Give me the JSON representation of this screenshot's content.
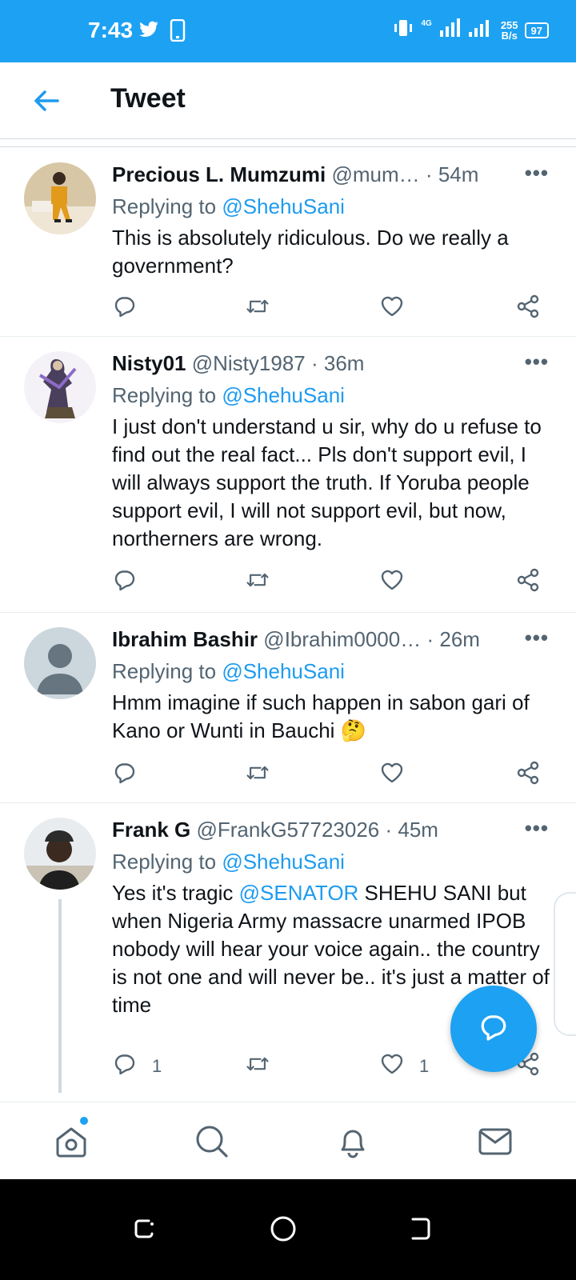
{
  "status_bar": {
    "time": "7:43",
    "network_type": "4G",
    "speed_value": "255",
    "speed_unit": "B/s",
    "battery": "97",
    "bg_color": "#1da1f2"
  },
  "header": {
    "title": "Tweet"
  },
  "tweets": [
    {
      "name": "Precious L. Mumzumi",
      "handle": "@mum…",
      "time": "54m",
      "replying_label": "Replying to",
      "replying_to": "@ShehuSani",
      "body": "This is absolutely ridiculous. Do we really a government?",
      "reply_count": "",
      "like_count": ""
    },
    {
      "name": "Nisty01",
      "handle": "@Nisty1987",
      "time": "36m",
      "replying_label": "Replying to",
      "replying_to": "@ShehuSani",
      "body": "I just don't understand u sir, why do u refuse to find out the real fact... Pls don't support evil, I will always support the truth. If Yoruba people support evil, I will not support evil, but now, northerners are wrong.",
      "reply_count": "",
      "like_count": ""
    },
    {
      "name": "Ibrahim Bashir",
      "handle": "@Ibrahim0000…",
      "time": "26m",
      "replying_label": "Replying to",
      "replying_to": "@ShehuSani",
      "body": "Hmm imagine if such happen in sabon gari of Kano or  Wunti in Bauchi 🤔",
      "reply_count": "",
      "like_count": ""
    },
    {
      "name": "Frank G",
      "handle": "@FrankG57723026",
      "time": "45m",
      "replying_label": "Replying to",
      "replying_to": "@ShehuSani",
      "body_pre": "Yes it's tragic ",
      "body_mention": "@SENATOR",
      "body_post": " SHEHU SANI but when Nigeria Army massacre unarmed IPOB nobody will hear your voice again.. the country is not one and will never be.. it's just a matter of time",
      "reply_count": "1",
      "like_count": "1"
    }
  ],
  "icons": {
    "back": "arrow-left-icon",
    "reply": "reply-icon",
    "retweet": "retweet-icon",
    "like": "heart-icon",
    "share": "share-icon",
    "more": "more-icon",
    "compose": "compose-reply-icon",
    "home": "home-icon",
    "search": "search-icon",
    "notifications": "bell-icon",
    "messages": "mail-icon"
  },
  "accent_color": "#1d9bf0"
}
